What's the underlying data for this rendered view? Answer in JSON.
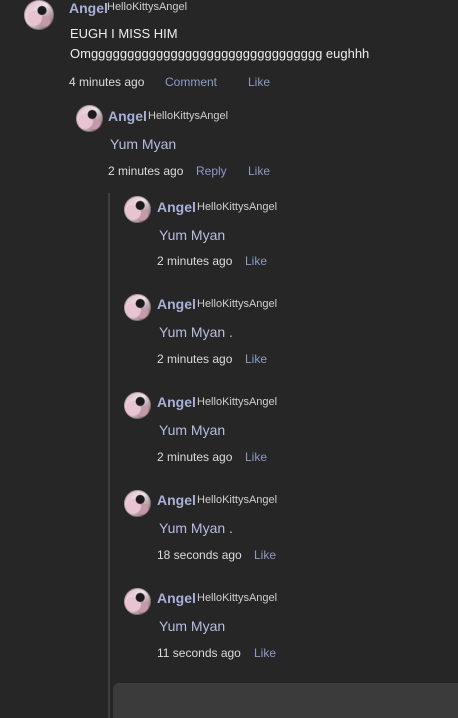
{
  "comment": {
    "name": "Angel",
    "handle": "HelloKittysAngel",
    "line1": "EUGH I MISS HIM",
    "line2": "Omgggggggggggggggggggggggggggggggg eughhh",
    "time": "4 minutes ago",
    "comment_label": "Comment",
    "like_label": "Like"
  },
  "reply": {
    "name": "Angel",
    "handle": "HelloKittysAngel",
    "text": "Yum Myan",
    "time": "2 minutes ago",
    "reply_label": "Reply",
    "like_label": "Like"
  },
  "nested": [
    {
      "name": "Angel",
      "handle": "HelloKittysAngel",
      "text": "Yum Myan",
      "time": "2 minutes ago",
      "like_label": "Like"
    },
    {
      "name": "Angel",
      "handle": "HelloKittysAngel",
      "text": "Yum Myan .",
      "time": "2 minutes ago",
      "like_label": "Like"
    },
    {
      "name": "Angel",
      "handle": "HelloKittysAngel",
      "text": "Yum Myan",
      "time": "2 minutes ago",
      "like_label": "Like"
    },
    {
      "name": "Angel",
      "handle": "HelloKittysAngel",
      "text": "Yum Myan .",
      "time": "18 seconds ago",
      "like_label": "Like"
    },
    {
      "name": "Angel",
      "handle": "HelloKittysAngel",
      "text": "Yum Myan",
      "time": "11 seconds ago",
      "like_label": "Like"
    }
  ]
}
